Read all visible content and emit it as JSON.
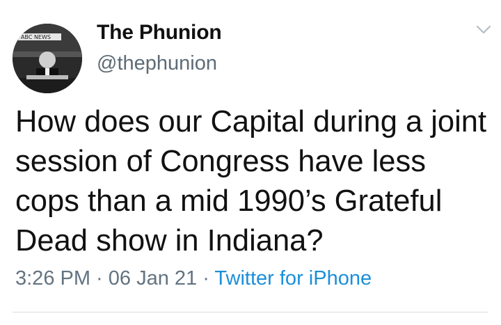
{
  "tweet": {
    "display_name": "The Phunion",
    "handle": "@thephunion",
    "text": "How does our Capital during a joint session of Congress have less cops than a mid 1990’s Grateful Dead show in Indiana?",
    "time": "3:26 PM",
    "separator": " · ",
    "date": "06 Jan 21",
    "source": "Twitter for iPhone",
    "avatar_logo_text": "ABC NEWS"
  },
  "colors": {
    "link": "#1b8fd9",
    "muted": "#637381"
  },
  "icons": {
    "menu": "chevron-down-icon",
    "avatar": "avatar"
  }
}
